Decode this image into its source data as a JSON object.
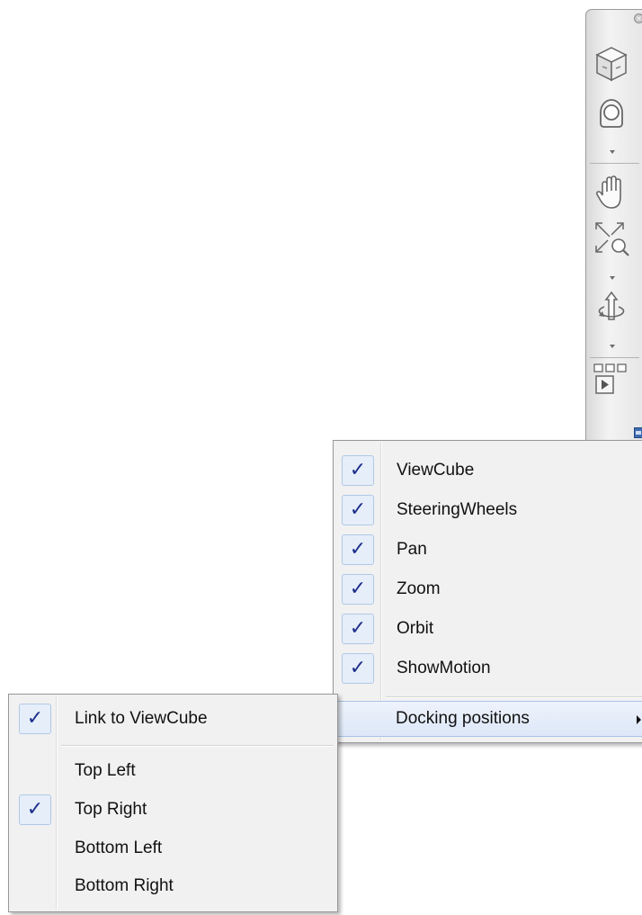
{
  "navbar": {
    "items": [
      {
        "name": "viewcube"
      },
      {
        "name": "steeringwheels"
      },
      {
        "name": "pan"
      },
      {
        "name": "zoom"
      },
      {
        "name": "orbit"
      },
      {
        "name": "showmotion"
      }
    ]
  },
  "main_menu": {
    "items": [
      {
        "label": "ViewCube",
        "checked": true
      },
      {
        "label": "SteeringWheels",
        "checked": true
      },
      {
        "label": "Pan",
        "checked": true
      },
      {
        "label": "Zoom",
        "checked": true
      },
      {
        "label": "Orbit",
        "checked": true
      },
      {
        "label": "ShowMotion",
        "checked": true
      }
    ],
    "docking_label": "Docking positions",
    "check_glyph": "✓"
  },
  "sub_menu": {
    "link_label": "Link to ViewCube",
    "link_checked": true,
    "positions": [
      {
        "label": "Top Left",
        "checked": false
      },
      {
        "label": "Top Right",
        "checked": true
      },
      {
        "label": "Bottom Left",
        "checked": false
      },
      {
        "label": "Bottom Right",
        "checked": false
      }
    ],
    "check_glyph": "✓"
  },
  "colors": {
    "menu_bg": "#f1f1f1",
    "check_color": "#1d2e8a",
    "highlight": "#dce7f8"
  }
}
